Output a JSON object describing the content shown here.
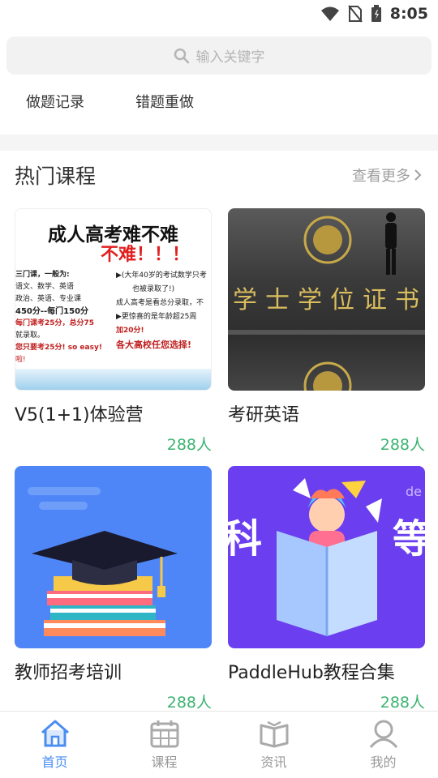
{
  "status": {
    "time": "8:05"
  },
  "search": {
    "placeholder": "输入关键字"
  },
  "quick_links": [
    "做题记录",
    "错题重做"
  ],
  "section": {
    "title": "热门课程",
    "more": "查看更多"
  },
  "courses": [
    {
      "title": "V5(1+1)体验营",
      "count": "288人",
      "thumb": {
        "headline": "成人高考难不难",
        "subhead": "不难！！！",
        "left_lines": [
          "三门课，一般为:",
          "语文、数学、英语",
          "政治、英语、专业课",
          "450分--每门150分",
          "每门课考25分，总分75",
          "就录取。",
          "您只要考25分! so easy!",
          "啦!"
        ],
        "right_lines": [
          "▶(大年40岁的考试数学只考",
          "也被录取了!)",
          "成人高考是看总分录取，不",
          "▶更惊喜的是年龄超25周",
          "加20分!",
          "各大高校任您选择!"
        ]
      }
    },
    {
      "title": "考研英语",
      "count": "288人",
      "thumb": {
        "text": "学士学位证书"
      }
    },
    {
      "title": "教师招考培训",
      "count": "288人",
      "thumb": {}
    },
    {
      "title": "PaddleHub教程合集",
      "count": "288人",
      "thumb": {
        "left_char": "科",
        "right_char": "等",
        "corner_text": "de"
      }
    }
  ],
  "tabs": [
    {
      "label": "首页",
      "icon": "home-icon",
      "active": true
    },
    {
      "label": "课程",
      "icon": "calendar-icon",
      "active": false
    },
    {
      "label": "资讯",
      "icon": "book-icon",
      "active": false
    },
    {
      "label": "我的",
      "icon": "user-icon",
      "active": false
    }
  ],
  "colors": {
    "accent": "#4a8ef0",
    "count": "#3cb371",
    "purple": "#6b3ef0",
    "blue_bg": "#4f86f7"
  }
}
